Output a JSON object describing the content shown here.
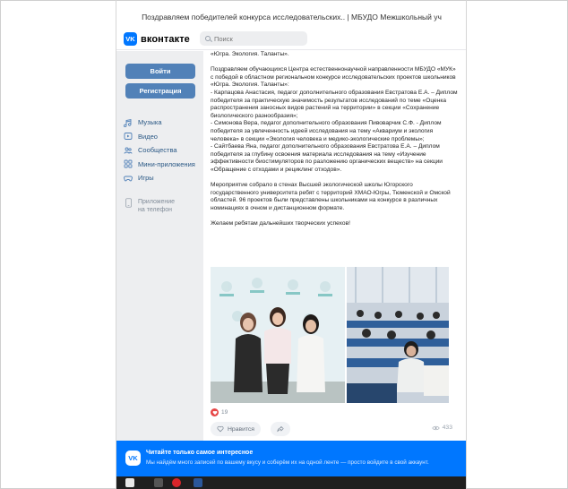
{
  "window": {
    "title": "Поздравляем победителей конкурса исследовательских.. | МБУДО Межшкольный уч"
  },
  "header": {
    "logo_text": "вконтакте",
    "logo_mark": "VK",
    "search_placeholder": "Поиск"
  },
  "sidebar": {
    "login_label": "Войти",
    "register_label": "Регистрация",
    "items": [
      {
        "label": "Музыка",
        "icon": "music-icon"
      },
      {
        "label": "Видео",
        "icon": "video-icon"
      },
      {
        "label": "Сообщества",
        "icon": "communities-icon"
      },
      {
        "label": "Мини-приложения",
        "icon": "mini-apps-icon"
      },
      {
        "label": "Игры",
        "icon": "games-icon"
      }
    ],
    "phone_app_line1": "Приложение",
    "phone_app_line2": "на телефон"
  },
  "post": {
    "paragraphs": [
      "«Югра. Экология. Таланты».",
      "Поздравляем обучающихся Центра естественнонаучной направленности МБУДО «МУК» с победой в областном региональном конкурсе исследовательских проектов школьников «Югра. Экология. Таланты»:\n- Карпацова Анастасия, педагог дополнительного образования Евстратова Е.А. – Диплом победителя за практическую значимость результатов исследований по теме «Оценка распространения заносных видов растений на территории» в секции «Сохранение биологического разнообразия»;\n- Симонова Вера, педагог дополнительного образования Пивоварчик С.Ф. - Диплом победителя за увлеченность идеей исследования на тему «Аквариум и экология человека» в секции «Экология человека и медико-экологические проблемы»;\n- Сайтбаева Яна, педагог дополнительного образования Евстратова Е.А. – Диплом победителя за глубину освоения материала исследования на тему «Изучение эффективности биостимуляторов по разложению органических веществ» на секции «Обращение с отходами и рециклинг отходов».",
      "Мероприятие собрало в стенах Высшей экологической школы Югорского государственного университета ребят с территорий ХМАО-Югры, Тюменской и Омской областей. 96 проектов были представлены школьниками на конкурсе в различных номинациях в очном и дистанционном формате.",
      "Желаем ребятам дальнейших творческих успехов!"
    ],
    "reactions_count": "19",
    "like_label": "Нравится",
    "views_count": "433"
  },
  "banner": {
    "logo_mark": "VK",
    "title": "Читайте только самое интересное",
    "subtitle": "Мы найдём много записей по вашему вкусу и соберём их на одной ленте — просто войдите в свой аккаунт."
  },
  "colors": {
    "vk_blue": "#0077ff",
    "button_blue": "#5181b8",
    "link_blue": "#2a5885",
    "heart_red": "#e64646"
  }
}
